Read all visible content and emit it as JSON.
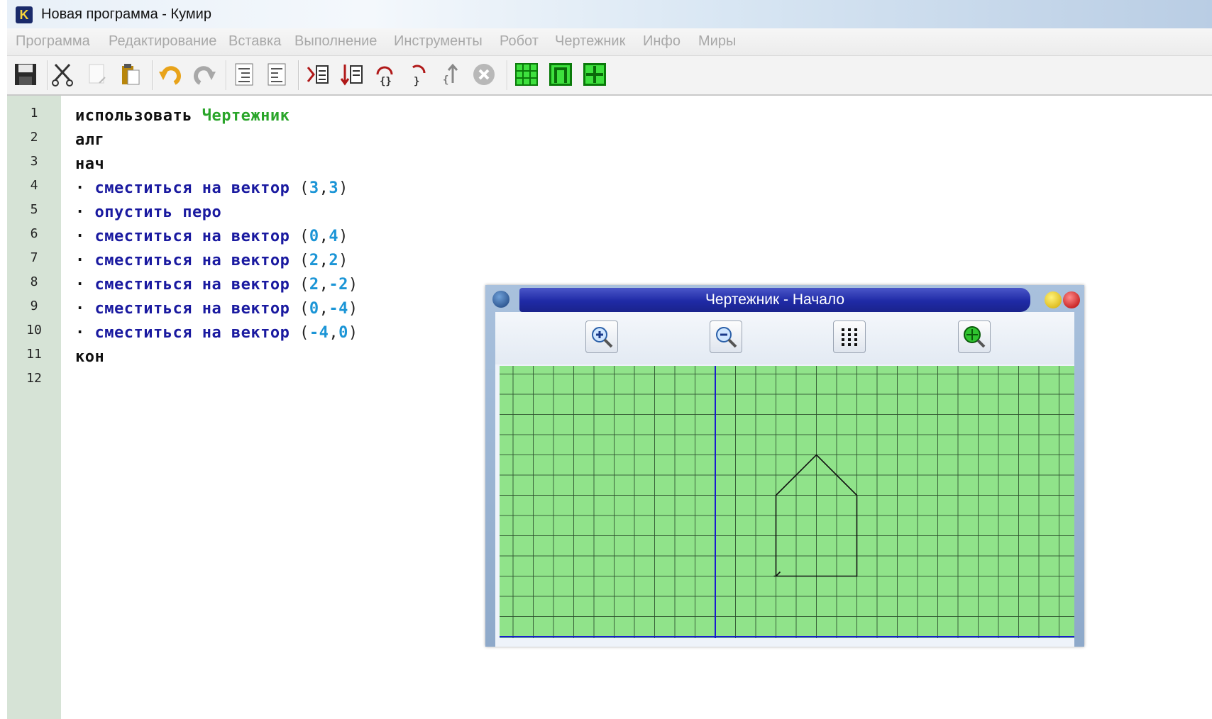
{
  "window": {
    "title": "Новая программа - Кумир",
    "icon_letter": "K"
  },
  "menu": [
    "Программа",
    "Редактирование",
    "Вставка",
    "Выполнение",
    "Инструменты",
    "Робот",
    "Чертежник",
    "Инфо",
    "Миры"
  ],
  "toolbar": {
    "icons": [
      "save-icon",
      "cut-icon",
      "copy-icon",
      "paste-icon",
      "undo-icon",
      "redo-icon",
      "indent-icon",
      "unindent-icon",
      "run-icon",
      "step-icon",
      "step-into-icon",
      "step-over-icon",
      "step-out-icon",
      "stop-icon",
      "robot-icon",
      "drawer-icon",
      "world-icon"
    ]
  },
  "editor": {
    "line_numbers": [
      "1",
      "2",
      "3",
      "4",
      "5",
      "6",
      "7",
      "8",
      "9",
      "10",
      "11",
      "12"
    ],
    "lines": [
      {
        "kw": "использовать",
        "mod": "Чертежник"
      },
      {
        "kw": "алг"
      },
      {
        "kw": "нач"
      },
      {
        "cmd": "сместиться на вектор",
        "args": [
          "3",
          "3"
        ]
      },
      {
        "cmd": "опустить перо"
      },
      {
        "cmd": "сместиться на вектор",
        "args": [
          "0",
          "4"
        ]
      },
      {
        "cmd": "сместиться на вектор",
        "args": [
          "2",
          "2"
        ]
      },
      {
        "cmd": "сместиться на вектор",
        "args": [
          "2",
          "-2"
        ]
      },
      {
        "cmd": "сместиться на вектор",
        "args": [
          "0",
          "-4"
        ]
      },
      {
        "cmd": "сместиться на вектор",
        "args": [
          "-4",
          "0"
        ]
      },
      {
        "kw": "кон"
      }
    ]
  },
  "drawer": {
    "title": "Чертежник - Начало",
    "buttons": [
      "zoom-in-icon",
      "zoom-out-icon",
      "grid-icon",
      "fit-icon"
    ],
    "colors": {
      "canvas_bg": "#90e38a",
      "grid": "#2b4d2b",
      "axis": "#1a1ad0",
      "pen": "#111111"
    },
    "path": [
      [
        3,
        3
      ],
      [
        3,
        7
      ],
      [
        5,
        9
      ],
      [
        7,
        7
      ],
      [
        7,
        3
      ],
      [
        3,
        3
      ]
    ]
  }
}
